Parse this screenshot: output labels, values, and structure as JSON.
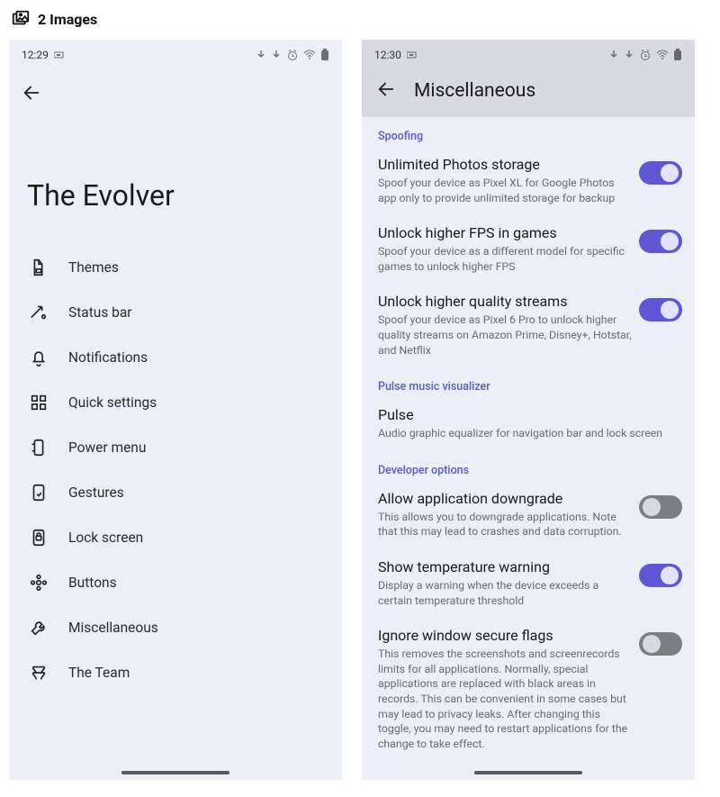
{
  "gallery": {
    "count_label": "2 Images"
  },
  "screen1": {
    "status": {
      "time": "12:29"
    },
    "title": "The Evolver",
    "menu": [
      {
        "icon": "themes-icon",
        "label": "Themes"
      },
      {
        "icon": "statusbar-icon",
        "label": "Status bar"
      },
      {
        "icon": "bell-icon",
        "label": "Notifications"
      },
      {
        "icon": "grid-icon",
        "label": "Quick settings"
      },
      {
        "icon": "power-icon",
        "label": "Power menu"
      },
      {
        "icon": "gesture-icon",
        "label": "Gestures"
      },
      {
        "icon": "lock-icon",
        "label": "Lock screen"
      },
      {
        "icon": "buttons-icon",
        "label": "Buttons"
      },
      {
        "icon": "wrench-icon",
        "label": "Miscellaneous"
      },
      {
        "icon": "team-icon",
        "label": "The Team"
      }
    ]
  },
  "screen2": {
    "status": {
      "time": "12:30"
    },
    "header": "Miscellaneous",
    "sections": {
      "spoofing": {
        "label": "Spoofing",
        "items": [
          {
            "title": "Unlimited Photos storage",
            "desc": "Spoof your device as Pixel XL for Google Photos app only to provide unlimited storage for backup",
            "on": true
          },
          {
            "title": "Unlock higher FPS in games",
            "desc": "Spoof your device as a different model for specific games to unlock higher FPS",
            "on": true
          },
          {
            "title": "Unlock higher quality streams",
            "desc": "Spoof your device as Pixel 6 Pro to unlock higher quality streams on Amazon Prime, Disney+, Hotstar, and Netflix",
            "on": true
          }
        ]
      },
      "pulse": {
        "label": "Pulse music visualizer",
        "items": [
          {
            "title": "Pulse",
            "desc": "Audio graphic equalizer for navigation bar and lock screen",
            "on": null
          }
        ]
      },
      "developer": {
        "label": "Developer options",
        "items": [
          {
            "title": "Allow application downgrade",
            "desc": "This allows you to downgrade applications. Note that this may lead to crashes and data corruption.",
            "on": false
          },
          {
            "title": "Show temperature warning",
            "desc": "Display a warning when the device exceeds a certain temperature threshold",
            "on": true
          },
          {
            "title": "Ignore window secure flags",
            "desc": "This removes the screenshots and screenrecords limits for all applications. Normally, special applications are replaced with black areas in records. This can be convenient in some cases but may lead to privacy leaks. After changing this toggle, you may need to restart applications for the change to take effect.",
            "on": false
          }
        ]
      }
    }
  }
}
